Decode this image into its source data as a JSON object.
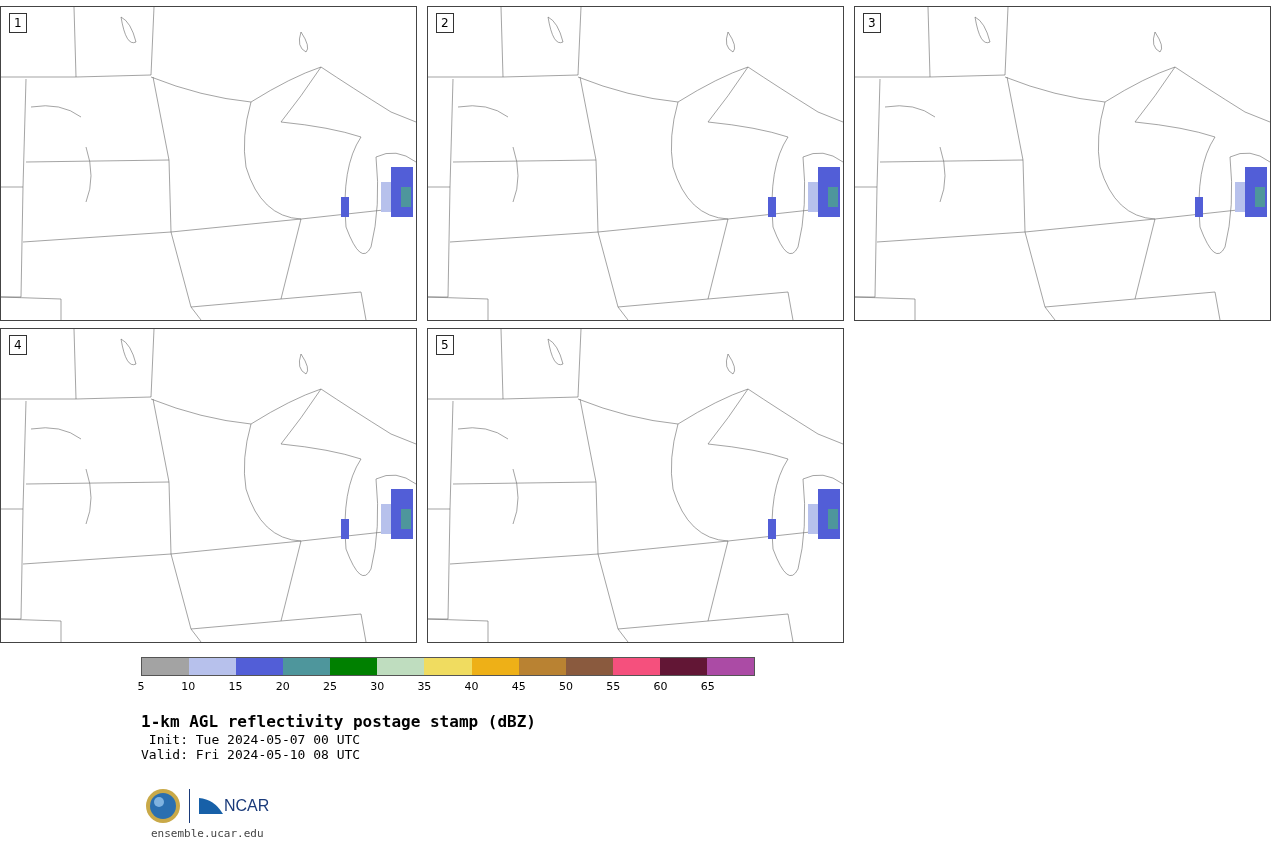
{
  "panels": [
    {
      "label": "1"
    },
    {
      "label": "2"
    },
    {
      "label": "3"
    },
    {
      "label": "4"
    },
    {
      "label": "5"
    }
  ],
  "colorbar": {
    "bins": [
      {
        "color": "#a3a3a3"
      },
      {
        "color": "#b7c1ec"
      },
      {
        "color": "#525ed7"
      },
      {
        "color": "#4e969c"
      },
      {
        "color": "#008000"
      },
      {
        "color": "#bfddbf"
      },
      {
        "color": "#f0dc60"
      },
      {
        "color": "#eeb017"
      },
      {
        "color": "#b98232"
      },
      {
        "color": "#8a5a3e"
      },
      {
        "color": "#f5507d"
      },
      {
        "color": "#621635"
      },
      {
        "color": "#ab4ba5"
      }
    ],
    "ticks": [
      "5",
      "10",
      "15",
      "20",
      "25",
      "30",
      "35",
      "40",
      "45",
      "50",
      "55",
      "60",
      "65"
    ]
  },
  "title": "1-km AGL reflectivity postage stamp (dBZ)",
  "init": " Init: Tue 2024-05-07 00 UTC",
  "valid": "Valid: Fri 2024-05-10 08 UTC",
  "footer": {
    "logo_text": "NCAR",
    "url": "ensemble.ucar.edu"
  }
}
